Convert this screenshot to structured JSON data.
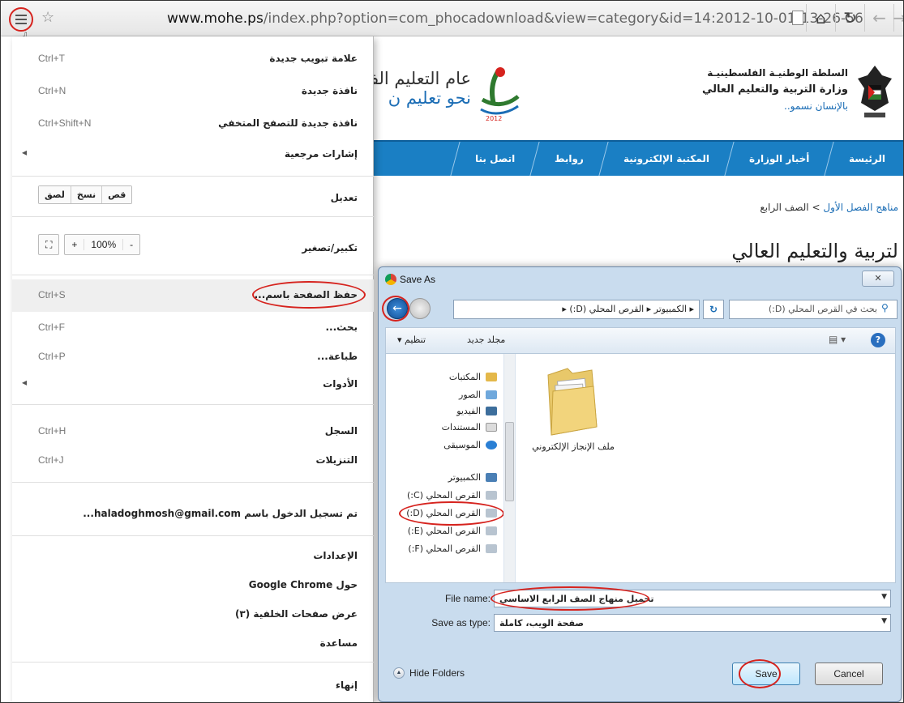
{
  "browser": {
    "url_domain": "www.mohe.ps",
    "url_path": "/index.php?option=com_phocadownload&view=category&id=14:2012-10-01-13-26-56"
  },
  "site": {
    "org_line1": "السلطة الوطنيـة الفلسطينيـة",
    "org_line2": "وزارة التربية والتعليم العالي",
    "org_line3": "بالإنسان نسمو..",
    "year_line1": "عام التعليم الف",
    "year_line2": "نحو تعليم ن",
    "nav": [
      "الرئيسة",
      "أخبار الوزارة",
      "المكتبة الإلكترونية",
      "روابط",
      "اتصل بنا"
    ],
    "breadcrumb_link": "مناهج الفصل الأول",
    "breadcrumb_sep": ">",
    "breadcrumb_current": "الصف الرابع",
    "heading": "لتربية والتعليم العالي"
  },
  "menu": {
    "new_tab": {
      "label": "علامة تبويب جديدة",
      "shortcut": "Ctrl+T"
    },
    "new_window": {
      "label": "نافذة جديدة",
      "shortcut": "Ctrl+N"
    },
    "incognito": {
      "label": "نافذة جديدة للتصفح المتخفي",
      "shortcut": "Ctrl+Shift+N"
    },
    "bookmarks": {
      "label": "إشارات مرجعية"
    },
    "edit": {
      "label": "تعديل",
      "cut": "قص",
      "copy": "نسخ",
      "paste": "لصق"
    },
    "zoom": {
      "label": "تكبير/تصغير",
      "minus": "-",
      "value": "100%",
      "plus": "+"
    },
    "save_page": {
      "label": "حفظ الصفحة باسم...",
      "shortcut": "Ctrl+S"
    },
    "find": {
      "label": "بحث...",
      "shortcut": "Ctrl+F"
    },
    "print": {
      "label": "طباعة...",
      "shortcut": "Ctrl+P"
    },
    "tools": {
      "label": "الأدوات"
    },
    "history": {
      "label": "السجل",
      "shortcut": "Ctrl+H"
    },
    "downloads": {
      "label": "التنزيلات",
      "shortcut": "Ctrl+J"
    },
    "signed_in": {
      "label": "تم تسجيل الدخول باسم haladoghmosh@gmail.com..."
    },
    "settings": {
      "label": "الإعدادات"
    },
    "about": {
      "label": "حول Google Chrome"
    },
    "background_pages": {
      "label": "عرض صفحات الخلفية (٣)"
    },
    "help": {
      "label": "مساعدة"
    },
    "exit": {
      "label": "إنهاء"
    }
  },
  "dialog": {
    "title": "Save As",
    "close": "✕",
    "address": "▸ الكمبيوتر ▸ القرص المحلي (D:) ▸",
    "search_placeholder": "بحث في القرص المحلي (D:)",
    "organize": "تنظيم ▾",
    "new_folder": "مجلد جديد",
    "nav_tree": [
      {
        "label": "المكتبات",
        "color": "#e4b84a"
      },
      {
        "label": "الصور",
        "color": "#6fa8dc"
      },
      {
        "label": "الفيديو",
        "color": "#3d6e9c"
      },
      {
        "label": "المستندات",
        "color": "#dcdcdc"
      },
      {
        "label": "الموسيقى",
        "color": "#2a7fd4"
      },
      {
        "label": "الكمبيوتر",
        "color": "#4a7fb5"
      },
      {
        "label": "القرص المحلي (C:)",
        "color": "#b8c4d0"
      },
      {
        "label": "القرص المحلي (D:)",
        "color": "#b8c4d0"
      },
      {
        "label": "القرص المحلي (E:)",
        "color": "#b8c4d0"
      },
      {
        "label": "القرص المحلي (F:)",
        "color": "#b8c4d0"
      }
    ],
    "folder_name": "ملف الإنجاز الإلكتروني",
    "filename_label": "File name:",
    "filename_value": "تحميل منهاج الصف الرابع الاساسي",
    "savetype_label": "Save as type:",
    "savetype_value": "صفحة الويب، كاملة",
    "hide_folders": "Hide Folders",
    "save": "Save",
    "cancel": "Cancel"
  }
}
